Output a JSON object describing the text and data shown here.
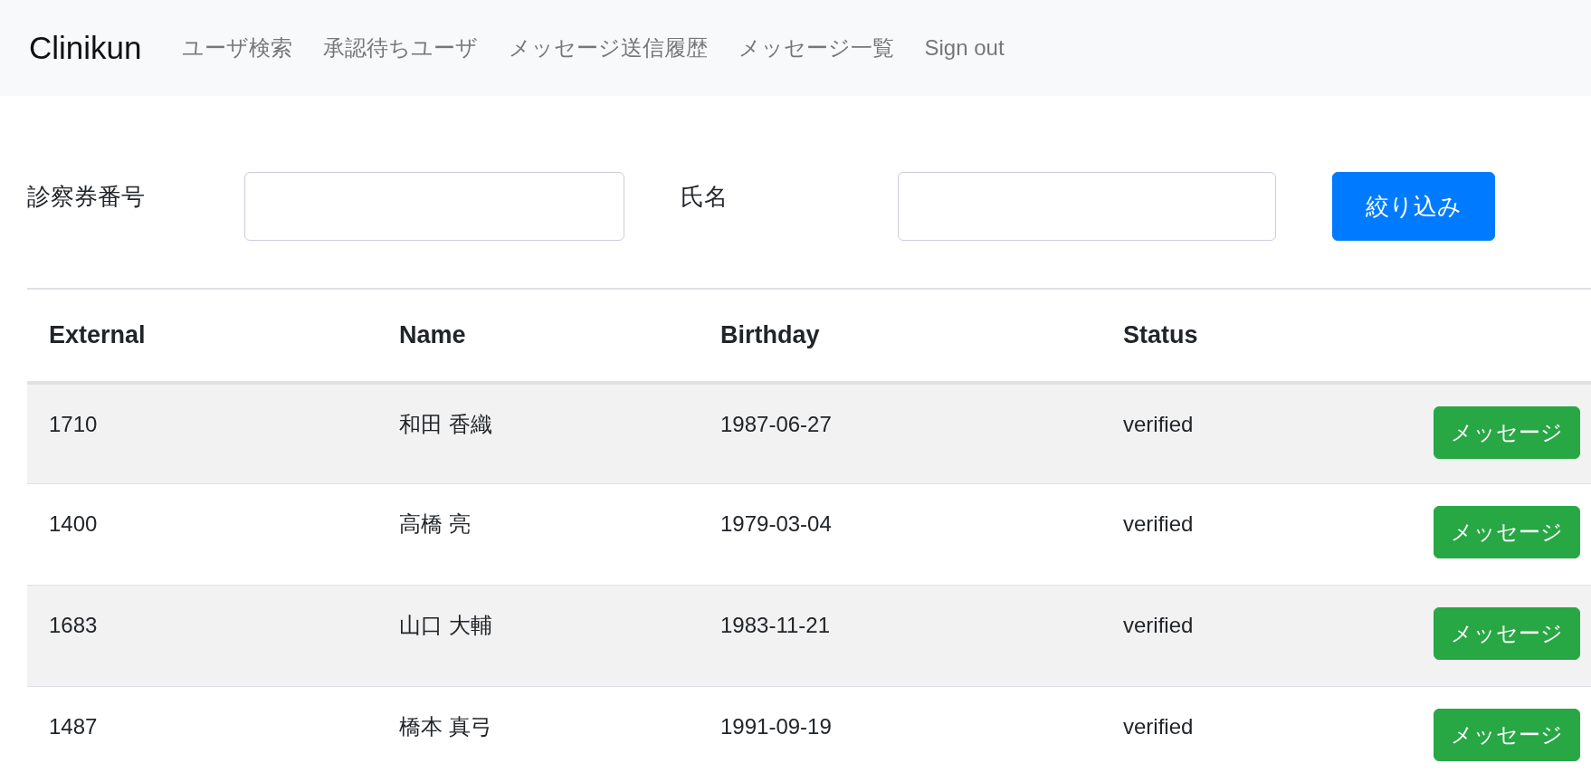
{
  "navbar": {
    "brand": "Clinikun",
    "links": [
      "ユーザ検索",
      "承認待ちユーザ",
      "メッセージ送信履歴",
      "メッセージ一覧",
      "Sign out"
    ]
  },
  "filter": {
    "fields": [
      {
        "label": "診察券番号"
      },
      {
        "label": "氏名"
      }
    ],
    "button": "絞り込み"
  },
  "table": {
    "columns": [
      "External",
      "Name",
      "Birthday",
      "Status"
    ],
    "rows": [
      {
        "external": "1710",
        "name": "和田 香織",
        "birthday": "1987-06-27",
        "status": "verified",
        "action": "メッセージ"
      },
      {
        "external": "1400",
        "name": "高橋 亮",
        "birthday": "1979-03-04",
        "status": "verified",
        "action": "メッセージ"
      },
      {
        "external": "1683",
        "name": "山口 大輔",
        "birthday": "1983-11-21",
        "status": "verified",
        "action": "メッセージ"
      },
      {
        "external": "1487",
        "name": "橋本 真弓",
        "birthday": "1991-09-19",
        "status": "verified",
        "action": "メッセージ"
      }
    ]
  }
}
